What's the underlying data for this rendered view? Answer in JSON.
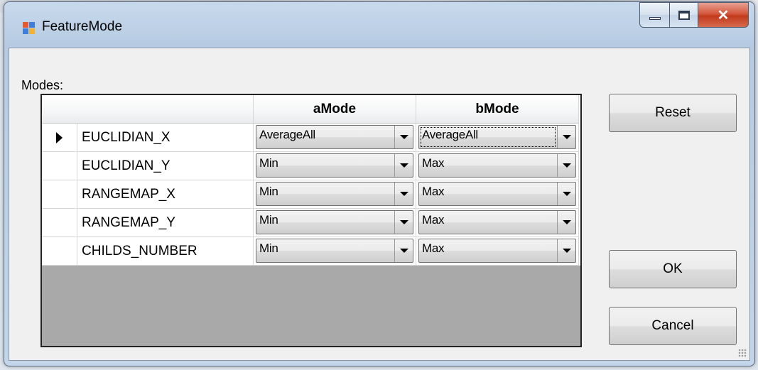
{
  "window": {
    "title": "FeatureMode"
  },
  "form": {
    "modes_label": "Modes:",
    "columns": [
      "aMode",
      "bMode"
    ],
    "rows": [
      {
        "name": "EUCLIDIAN_X",
        "aMode": "AverageAll",
        "bMode": "AverageAll",
        "selected": true
      },
      {
        "name": "EUCLIDIAN_Y",
        "aMode": "Min",
        "bMode": "Max",
        "selected": false
      },
      {
        "name": "RANGEMAP_X",
        "aMode": "Min",
        "bMode": "Max",
        "selected": false
      },
      {
        "name": "RANGEMAP_Y",
        "aMode": "Min",
        "bMode": "Max",
        "selected": false
      },
      {
        "name": "CHILDS_NUMBER",
        "aMode": "Min",
        "bMode": "Max",
        "selected": false
      }
    ]
  },
  "buttons": {
    "reset": "Reset",
    "ok": "OK",
    "cancel": "Cancel"
  },
  "icons": {
    "app": "form-app-icon",
    "minimize": "minimize-icon",
    "maximize": "maximize-icon",
    "close": "close-icon",
    "row_selector": "row-selector-arrow-icon",
    "dropdown": "chevron-down-icon"
  }
}
